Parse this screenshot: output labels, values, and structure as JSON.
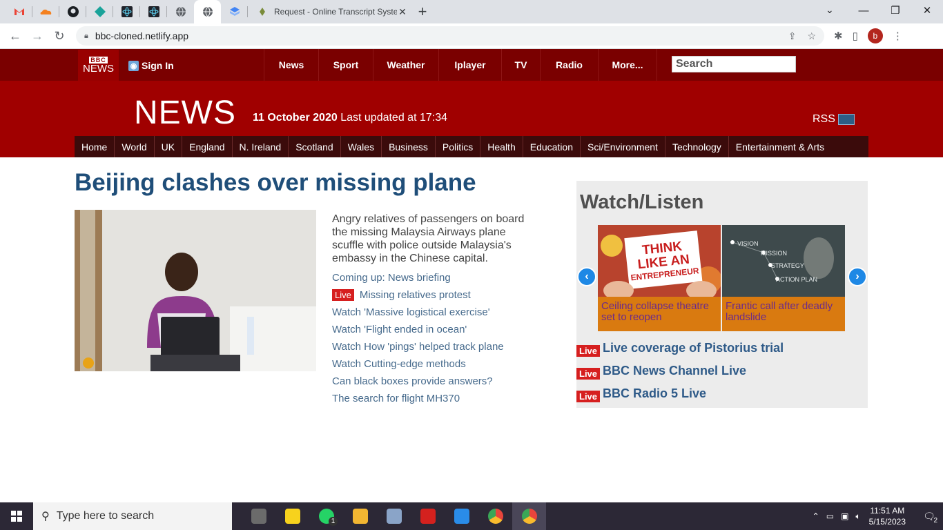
{
  "browser": {
    "tabs": [
      {
        "icon": "gmail-icon"
      },
      {
        "icon": "cloudflare-icon"
      },
      {
        "icon": "github-icon"
      },
      {
        "icon": "diamond-icon"
      },
      {
        "icon": "react-icon"
      },
      {
        "icon": "react-icon"
      },
      {
        "icon": "globe-icon"
      },
      {
        "icon": "globe-icon",
        "active": true
      },
      {
        "icon": "cube-icon"
      }
    ],
    "titled_tab": "Request - Online Transcript Syste",
    "url": "bbc-cloned.netlify.app",
    "profile_initial": "b"
  },
  "bbc_bar": {
    "logo_top": "BBC",
    "logo_bottom": "NEWS",
    "signin": "Sign In",
    "nav": [
      "News",
      "Sport",
      "Weather",
      "Iplayer",
      "TV",
      "Radio",
      "More..."
    ],
    "search_placeholder": "Search"
  },
  "masthead": {
    "title": "NEWS",
    "date": "11 October 2020",
    "updated": "Last updated at 17:34",
    "rss": "RSS",
    "subnav": [
      "Home",
      "World",
      "UK",
      "England",
      "N. Ireland",
      "Scotland",
      "Wales",
      "Business",
      "Politics",
      "Health",
      "Education",
      "Sci/Environment",
      "Technology",
      "Entertainment & Arts"
    ]
  },
  "article": {
    "headline": "Beijing clashes over missing plane",
    "summary": "Angry relatives of passengers on board the missing Malaysia Airways plane scuffle with police outside Malaysia's embassy in the Chinese capital.",
    "live_label": "Live",
    "links": [
      {
        "text": "Coming up: News briefing",
        "live": false
      },
      {
        "text": "Missing relatives protest",
        "live": true
      },
      {
        "text": "Watch 'Massive logistical exercise'",
        "live": false
      },
      {
        "text": "Watch 'Flight ended in ocean'",
        "live": false
      },
      {
        "text": "Watch How 'pings' helped track plane",
        "live": false
      },
      {
        "text": "Watch Cutting-edge methods",
        "live": false
      },
      {
        "text": "Can black boxes provide answers?",
        "live": false
      },
      {
        "text": "The search for flight MH370",
        "live": false
      }
    ]
  },
  "watch": {
    "title": "Watch/Listen",
    "cards": [
      {
        "caption": "Ceiling collapse theatre set to reopen",
        "sign_lines": [
          "THINK",
          "LIKE AN",
          "ENTREPRENEUR"
        ]
      },
      {
        "caption": "Frantic call after deadly landslide",
        "sign_lines": [
          "VISION",
          "MISSION",
          "STRATEGY",
          "ACTION PLAN"
        ]
      }
    ],
    "live_links": [
      "Live coverage of Pistorius trial",
      "BBC News Channel Live",
      "BBC Radio 5 Live"
    ],
    "live_label": "Live"
  },
  "taskbar": {
    "search_placeholder": "Type here to search",
    "apps": [
      {
        "icon": "photos-icon",
        "color": "#6b6b6b"
      },
      {
        "icon": "sticky-notes-icon",
        "color": "#f7d21d"
      },
      {
        "icon": "whatsapp-icon",
        "color": "#25d366",
        "badge": "1"
      },
      {
        "icon": "file-explorer-icon",
        "color": "#f2b632"
      },
      {
        "icon": "screenshot-icon",
        "color": "#8aa4c8"
      },
      {
        "icon": "acrobat-icon",
        "color": "#d4211e"
      },
      {
        "icon": "vscode-icon",
        "color": "#2a8ce8"
      },
      {
        "icon": "chrome-icon",
        "color": "#e8453c"
      },
      {
        "icon": "chrome-profile-icon",
        "color": "#e8453c",
        "active": true
      }
    ],
    "time": "11:51 AM",
    "date": "5/15/2023",
    "notifications": "2"
  }
}
